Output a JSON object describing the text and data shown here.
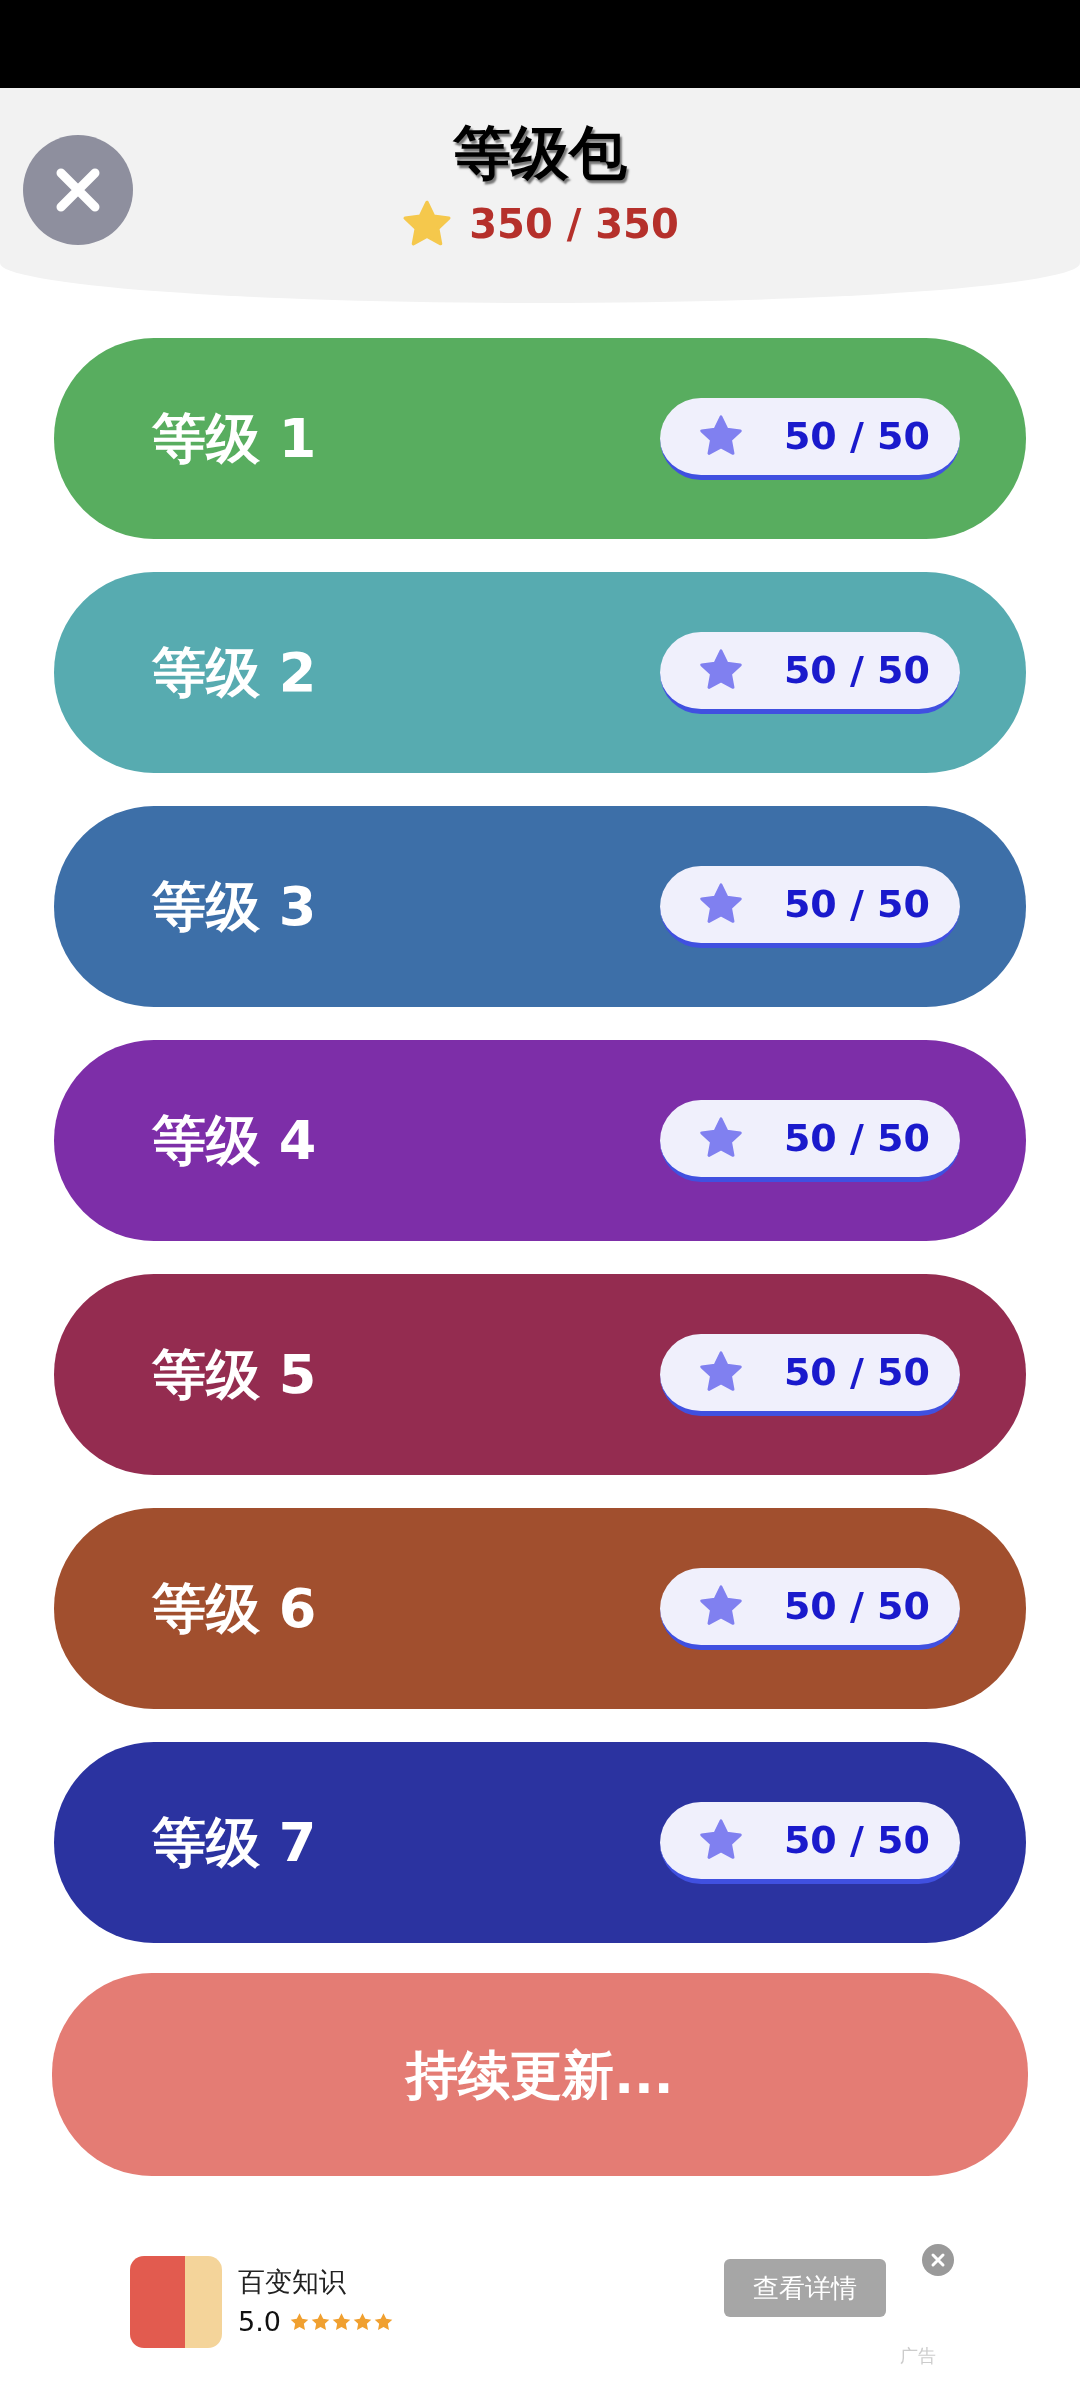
{
  "header": {
    "title": "等级包",
    "score": "350 / 350"
  },
  "levels": [
    {
      "label": "等级 1",
      "score": "50 / 50",
      "color": "#58ad5f"
    },
    {
      "label": "等级 2",
      "score": "50 / 50",
      "color": "#57abb0"
    },
    {
      "label": "等级 3",
      "score": "50 / 50",
      "color": "#3d6fa8"
    },
    {
      "label": "等级 4",
      "score": "50 / 50",
      "color": "#7d2ea8"
    },
    {
      "label": "等级 5",
      "score": "50 / 50",
      "color": "#942c50"
    },
    {
      "label": "等级 6",
      "score": "50 / 50",
      "color": "#a14f2e"
    },
    {
      "label": "等级 7",
      "score": "50 / 50",
      "color": "#2b33a0"
    }
  ],
  "more_button": "持续更新...",
  "ad": {
    "name": "百变知识",
    "rating": "5.0",
    "stars": 5,
    "button": "查看详情",
    "tag": "广告"
  }
}
